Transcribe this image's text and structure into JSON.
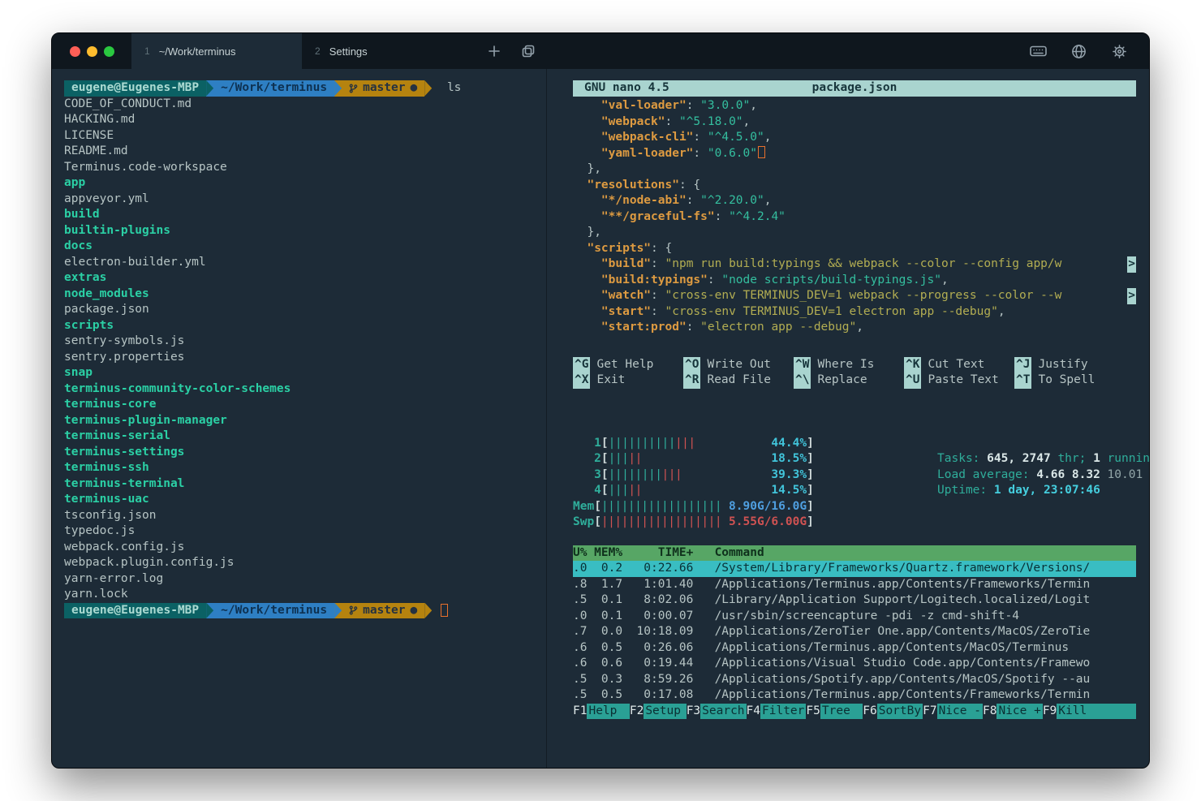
{
  "titlebar": {
    "window_controls": [
      "close",
      "minimize",
      "zoom"
    ],
    "tabs": [
      {
        "index": "1",
        "title": "~/Work/terminus",
        "active": true
      },
      {
        "index": "2",
        "title": "Settings",
        "active": false
      }
    ],
    "icons": {
      "new_tab": "plus-icon",
      "duplicate_tab": "copy-icon",
      "keyboard": "keyboard-icon",
      "language": "globe-icon",
      "settings": "gear-icon"
    }
  },
  "shell": {
    "prompt": {
      "user": "eugene@Eugenes-MBP",
      "path": "~/Work/terminus",
      "branch": "master",
      "dirty_dot": "●"
    },
    "command": "ls",
    "listing": [
      {
        "name": "CODE_OF_CONDUCT.md",
        "type": "file"
      },
      {
        "name": "HACKING.md",
        "type": "file"
      },
      {
        "name": "LICENSE",
        "type": "file"
      },
      {
        "name": "README.md",
        "type": "file"
      },
      {
        "name": "Terminus.code-workspace",
        "type": "file"
      },
      {
        "name": "app",
        "type": "dir"
      },
      {
        "name": "appveyor.yml",
        "type": "file"
      },
      {
        "name": "build",
        "type": "dir"
      },
      {
        "name": "builtin-plugins",
        "type": "dir"
      },
      {
        "name": "docs",
        "type": "dir"
      },
      {
        "name": "electron-builder.yml",
        "type": "file"
      },
      {
        "name": "extras",
        "type": "dir"
      },
      {
        "name": "node_modules",
        "type": "dir"
      },
      {
        "name": "package.json",
        "type": "file"
      },
      {
        "name": "scripts",
        "type": "dir"
      },
      {
        "name": "sentry-symbols.js",
        "type": "file"
      },
      {
        "name": "sentry.properties",
        "type": "file"
      },
      {
        "name": "snap",
        "type": "dir"
      },
      {
        "name": "terminus-community-color-schemes",
        "type": "dir"
      },
      {
        "name": "terminus-core",
        "type": "dir"
      },
      {
        "name": "terminus-plugin-manager",
        "type": "dir"
      },
      {
        "name": "terminus-serial",
        "type": "dir"
      },
      {
        "name": "terminus-settings",
        "type": "dir"
      },
      {
        "name": "terminus-ssh",
        "type": "dir"
      },
      {
        "name": "terminus-terminal",
        "type": "dir"
      },
      {
        "name": "terminus-uac",
        "type": "dir"
      },
      {
        "name": "tsconfig.json",
        "type": "file"
      },
      {
        "name": "typedoc.js",
        "type": "file"
      },
      {
        "name": "webpack.config.js",
        "type": "file"
      },
      {
        "name": "webpack.plugin.config.js",
        "type": "file"
      },
      {
        "name": "yarn-error.log",
        "type": "file"
      },
      {
        "name": "yarn.lock",
        "type": "file"
      }
    ]
  },
  "nano": {
    "header": {
      "app": "GNU nano 4.5",
      "file": "package.json"
    },
    "wrap_marker": ">",
    "lines": [
      {
        "spans": [
          [
            "    ",
            "d"
          ],
          [
            "\"val-loader\"",
            "k"
          ],
          [
            ": ",
            "d"
          ],
          [
            "\"3.0.0\"",
            "v"
          ],
          [
            ",",
            "d"
          ]
        ]
      },
      {
        "spans": [
          [
            "    ",
            "d"
          ],
          [
            "\"webpack\"",
            "k"
          ],
          [
            ": ",
            "d"
          ],
          [
            "\"^5.18.0\"",
            "v"
          ],
          [
            ",",
            "d"
          ]
        ]
      },
      {
        "spans": [
          [
            "    ",
            "d"
          ],
          [
            "\"webpack-cli\"",
            "k"
          ],
          [
            ": ",
            "d"
          ],
          [
            "\"^4.5.0\"",
            "v"
          ],
          [
            ",",
            "d"
          ]
        ]
      },
      {
        "spans": [
          [
            "    ",
            "d"
          ],
          [
            "\"yaml-loader\"",
            "k"
          ],
          [
            ": ",
            "d"
          ],
          [
            "\"0.6.0\"",
            "v"
          ]
        ],
        "cursor": true
      },
      {
        "spans": [
          [
            "  },",
            "d"
          ]
        ]
      },
      {
        "spans": [
          [
            "  ",
            "d"
          ],
          [
            "\"resolutions\"",
            "k"
          ],
          [
            ": {",
            "d"
          ]
        ]
      },
      {
        "spans": [
          [
            "    ",
            "d"
          ],
          [
            "\"*/node-abi\"",
            "k"
          ],
          [
            ": ",
            "d"
          ],
          [
            "\"^2.20.0\"",
            "v"
          ],
          [
            ",",
            "d"
          ]
        ]
      },
      {
        "spans": [
          [
            "    ",
            "d"
          ],
          [
            "\"**/graceful-fs\"",
            "k"
          ],
          [
            ": ",
            "d"
          ],
          [
            "\"^4.2.4\"",
            "v"
          ]
        ]
      },
      {
        "spans": [
          [
            "  },",
            "d"
          ]
        ]
      },
      {
        "spans": [
          [
            "  ",
            "d"
          ],
          [
            "\"scripts\"",
            "k"
          ],
          [
            ": {",
            "d"
          ]
        ]
      },
      {
        "spans": [
          [
            "    ",
            "d"
          ],
          [
            "\"build\"",
            "k"
          ],
          [
            ": ",
            "d"
          ],
          [
            "\"npm run build:typings && webpack --color --config app/w",
            "y"
          ]
        ],
        "wrap": true
      },
      {
        "spans": [
          [
            "    ",
            "d"
          ],
          [
            "\"build:typings\"",
            "k"
          ],
          [
            ": ",
            "d"
          ],
          [
            "\"node scripts/build-typings.js\"",
            "v"
          ],
          [
            ",",
            "d"
          ]
        ]
      },
      {
        "spans": [
          [
            "    ",
            "d"
          ],
          [
            "\"watch\"",
            "k"
          ],
          [
            ": ",
            "d"
          ],
          [
            "\"cross-env TERMINUS_DEV=1 webpack --progress --color --w",
            "y"
          ]
        ],
        "wrap": true
      },
      {
        "spans": [
          [
            "    ",
            "d"
          ],
          [
            "\"start\"",
            "k"
          ],
          [
            ": ",
            "d"
          ],
          [
            "\"cross-env TERMINUS_DEV=1 electron app --debug\"",
            "y"
          ],
          [
            ",",
            "d"
          ]
        ]
      },
      {
        "spans": [
          [
            "    ",
            "d"
          ],
          [
            "\"start:prod\"",
            "k"
          ],
          [
            ": ",
            "d"
          ],
          [
            "\"electron app --debug\"",
            "y"
          ],
          [
            ",",
            "d"
          ]
        ]
      }
    ],
    "shortcuts": [
      [
        {
          "key": "^G",
          "label": "Get Help"
        },
        {
          "key": "^O",
          "label": "Write Out"
        },
        {
          "key": "^W",
          "label": "Where Is"
        },
        {
          "key": "^K",
          "label": "Cut Text"
        },
        {
          "key": "^J",
          "label": "Justify"
        }
      ],
      [
        {
          "key": "^X",
          "label": "Exit"
        },
        {
          "key": "^R",
          "label": "Read File"
        },
        {
          "key": "^\\",
          "label": "Replace"
        },
        {
          "key": "^U",
          "label": "Paste Text"
        },
        {
          "key": "^T",
          "label": "To Spell"
        }
      ]
    ]
  },
  "htop": {
    "cpus": [
      {
        "id": "1",
        "teal": 10,
        "red": 3,
        "pct": "44.4%"
      },
      {
        "id": "2",
        "teal": 3,
        "red": 2,
        "pct": "18.5%"
      },
      {
        "id": "3",
        "teal": 8,
        "red": 3,
        "pct": "39.3%"
      },
      {
        "id": "4",
        "teal": 3,
        "red": 2,
        "pct": "14.5%"
      }
    ],
    "mem": {
      "label": "Mem",
      "bars": 18,
      "value": "8.90G/16.0G"
    },
    "swp": {
      "label": "Swp",
      "bars": 18,
      "value": "5.55G/6.00G"
    },
    "stats": {
      "tasks_label": "Tasks: ",
      "tasks_value": "645, 2747",
      "tasks_thr": " thr; ",
      "tasks_running": "1",
      "tasks_tail": " running",
      "load_label": "Load average: ",
      "load_value": "4.66 8.32",
      "load_tail": " 10.01",
      "uptime_label": "Uptime: ",
      "uptime_value": "1 day, 23:07:46"
    },
    "table": {
      "headers": {
        "u": "U%",
        "mem": "MEM%",
        "time": "TIME+",
        "cmd": "Command"
      },
      "rows": [
        {
          "u": ".0",
          "mem": "0.2",
          "time": "0:22.66",
          "cmd": "/System/Library/Frameworks/Quartz.framework/Versions/",
          "selected": true
        },
        {
          "u": ".8",
          "mem": "1.7",
          "time": "1:01.40",
          "cmd": "/Applications/Terminus.app/Contents/Frameworks/Termin",
          "selected": false
        },
        {
          "u": ".5",
          "mem": "0.1",
          "time": "8:02.06",
          "cmd": "/Library/Application Support/Logitech.localized/Logit",
          "selected": false
        },
        {
          "u": ".0",
          "mem": "0.1",
          "time": "0:00.07",
          "cmd": "/usr/sbin/screencapture -pdi -z cmd-shift-4",
          "selected": false
        },
        {
          "u": ".7",
          "mem": "0.0",
          "time": "10:18.09",
          "cmd": "/Applications/ZeroTier One.app/Contents/MacOS/ZeroTie",
          "selected": false
        },
        {
          "u": ".6",
          "mem": "0.5",
          "time": "0:26.06",
          "cmd": "/Applications/Terminus.app/Contents/MacOS/Terminus",
          "selected": false
        },
        {
          "u": ".6",
          "mem": "0.6",
          "time": "0:19.44",
          "cmd": "/Applications/Visual Studio Code.app/Contents/Framewo",
          "selected": false
        },
        {
          "u": ".5",
          "mem": "0.3",
          "time": "8:59.26",
          "cmd": "/Applications/Spotify.app/Contents/MacOS/Spotify --au",
          "selected": false
        },
        {
          "u": ".5",
          "mem": "0.5",
          "time": "0:17.08",
          "cmd": "/Applications/Terminus.app/Contents/Frameworks/Termin",
          "selected": false
        }
      ]
    },
    "fnbar": [
      {
        "key": "F1",
        "label": "Help"
      },
      {
        "key": "F2",
        "label": "Setup"
      },
      {
        "key": "F3",
        "label": "Search"
      },
      {
        "key": "F4",
        "label": "Filter"
      },
      {
        "key": "F5",
        "label": "Tree"
      },
      {
        "key": "F6",
        "label": "SortBy"
      },
      {
        "key": "F7",
        "label": "Nice -"
      },
      {
        "key": "F8",
        "label": "Nice +"
      },
      {
        "key": "F9",
        "label": "Kill"
      }
    ]
  }
}
